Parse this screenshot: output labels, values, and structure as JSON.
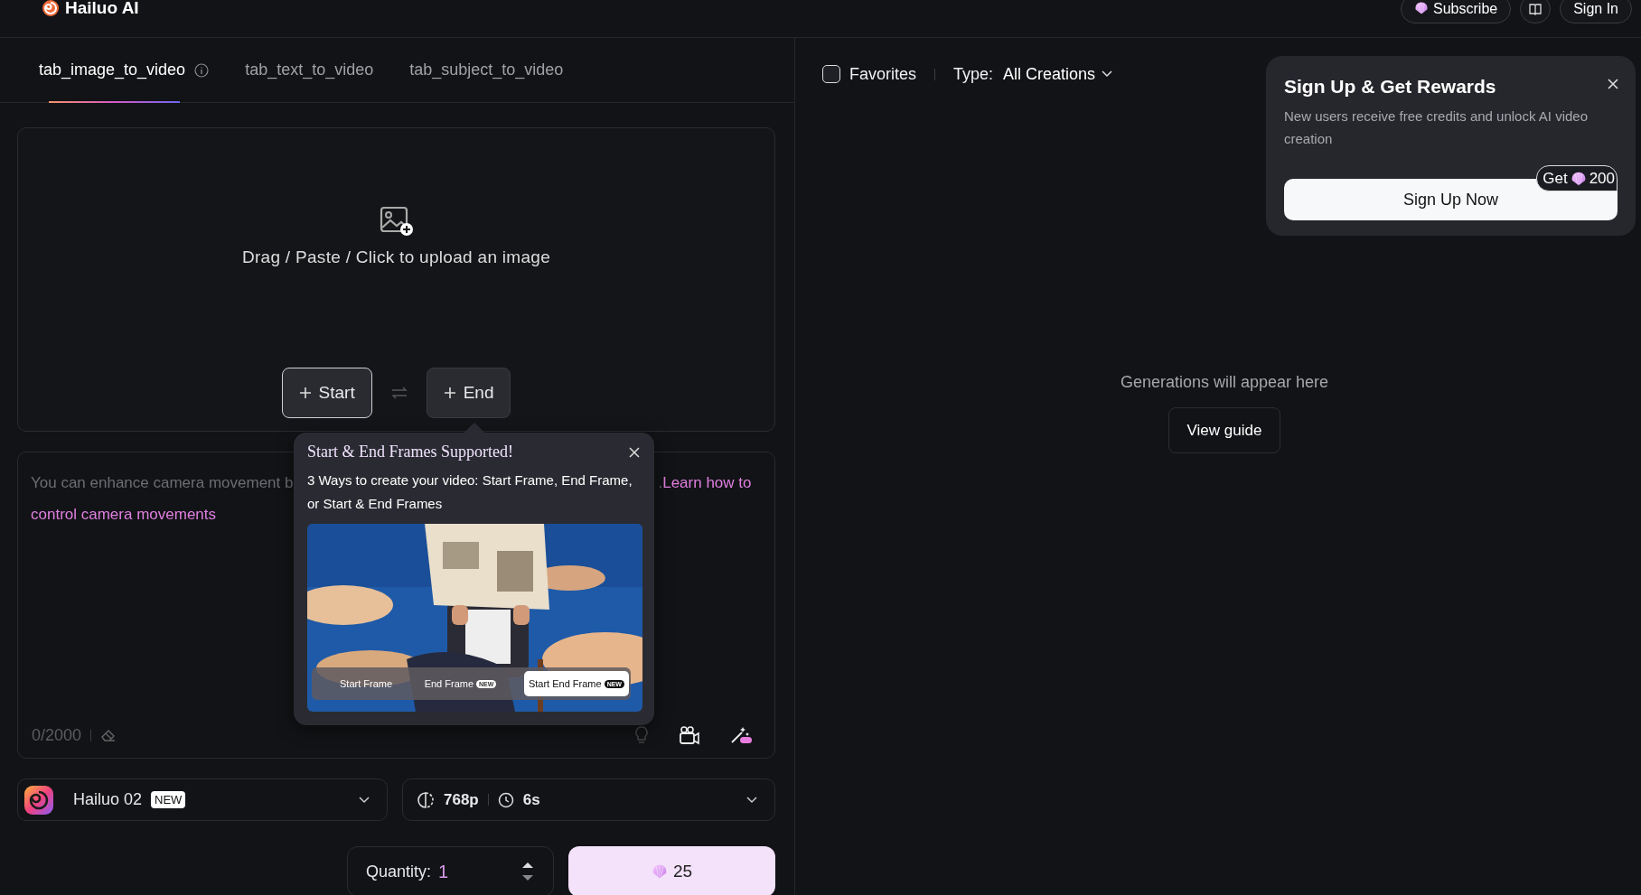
{
  "header": {
    "logo": "Hailuo AI",
    "subscribe": "Subscribe",
    "sign_in": "Sign In"
  },
  "tabs": [
    {
      "label": "tab_image_to_video",
      "selected": true,
      "info": true
    },
    {
      "label": "tab_text_to_video",
      "selected": false,
      "info": false
    },
    {
      "label": "tab_subject_to_video",
      "selected": false,
      "info": false
    }
  ],
  "upload": {
    "hint": "Drag / Paste / Click to upload an image",
    "frames": [
      {
        "label": "Start",
        "selected": true
      },
      {
        "label": "End",
        "selected": false
      }
    ]
  },
  "prompt": {
    "hint_start": "You can enhance camera movement b",
    "hint_end": ".",
    "link_lines": [
      "Learn how to",
      "control camera movements"
    ],
    "counter": "0/2000"
  },
  "popover": {
    "title": "Start & End Frames Supported!",
    "text": "3 Ways to create your video: Start Frame, End Frame, or Start & End Frames",
    "modes": [
      {
        "label": "Start Frame",
        "selected": false
      },
      {
        "label": "End Frame",
        "badge": "NEW",
        "selected": false
      },
      {
        "label": "Start End Frame",
        "badge": "NEW",
        "selected": true
      }
    ]
  },
  "model": {
    "name": "Hailuo 02",
    "badge": "NEW"
  },
  "settings": {
    "resolution": "768p",
    "duration": "6s"
  },
  "quantity": {
    "label": "Quantity:",
    "value": "1"
  },
  "generate": {
    "cost": "25"
  },
  "filters": {
    "favorites": {
      "label": "Favorites",
      "checked": false
    },
    "type_label": "Type:",
    "type_value": "All Creations"
  },
  "empty": {
    "message": "Generations will appear here",
    "button": "View guide"
  },
  "signup": {
    "title": "Sign Up & Get Rewards",
    "text": "New users receive free credits and unlock AI video creation",
    "button": "Sign Up Now",
    "bonus_prefix": "Get",
    "bonus_amount": "200"
  }
}
